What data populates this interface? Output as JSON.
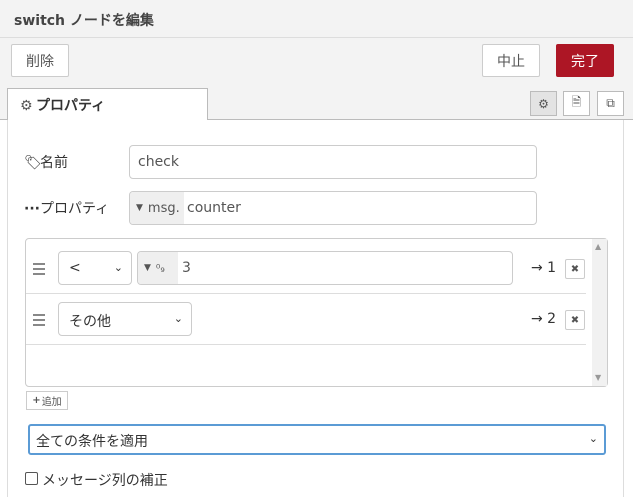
{
  "dialog": {
    "title": "switch ノードを編集"
  },
  "toolbar": {
    "delete_label": "削除",
    "cancel_label": "中止",
    "done_label": "完了"
  },
  "tabs": {
    "properties_label": "プロパティ"
  },
  "form": {
    "name_label": "名前",
    "name_value": "check",
    "property_label": "プロパティ",
    "property_type": "msg.",
    "property_value": "counter"
  },
  "rules": [
    {
      "operator": "<",
      "value_type": "⁰₉",
      "value": "3",
      "output": "→ 1"
    },
    {
      "operator": "その他",
      "output": "→ 2"
    }
  ],
  "add_label": "追加",
  "check_all": {
    "selected": "全ての条件を適用"
  },
  "repair": {
    "label": "メッセージ列の補正",
    "checked": false
  },
  "colors": {
    "accent": "#ad1625",
    "focus": "#5b9bd5"
  }
}
